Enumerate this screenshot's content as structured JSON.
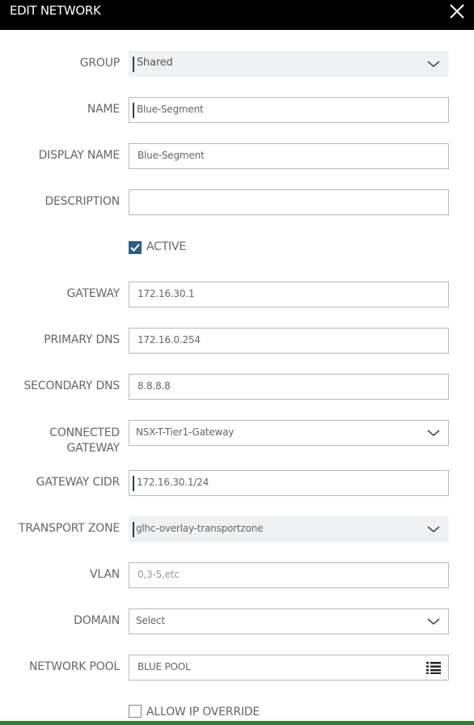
{
  "dialog": {
    "title": "EDIT NETWORK"
  },
  "form": {
    "group": {
      "label": "GROUP",
      "value": "Shared"
    },
    "name": {
      "label": "NAME",
      "value": "Blue-Segment"
    },
    "display_name": {
      "label": "DISPLAY NAME",
      "value": "Blue-Segment"
    },
    "description": {
      "label": "DESCRIPTION",
      "value": ""
    },
    "active": {
      "label": "ACTIVE",
      "checked": true
    },
    "gateway": {
      "label": "GATEWAY",
      "value": "172.16.30.1"
    },
    "primary_dns": {
      "label": "PRIMARY DNS",
      "value": "172.16.0.254"
    },
    "secondary_dns": {
      "label": "SECONDARY DNS",
      "value": "8.8.8.8"
    },
    "connected_gateway": {
      "label_line1": "CONNECTED",
      "label_line2": "GATEWAY",
      "value": "NSX-T-Tier1-Gateway"
    },
    "gateway_cidr": {
      "label": "GATEWAY CIDR",
      "value": "172.16.30.1/24"
    },
    "transport_zone": {
      "label": "TRANSPORT ZONE",
      "value": "glhc-overlay-transportzone"
    },
    "vlan": {
      "label": "VLAN",
      "placeholder": "0,3-5,etc"
    },
    "domain": {
      "label": "DOMAIN",
      "value": "Select"
    },
    "network_pool": {
      "label": "NETWORK POOL",
      "value": "BLUE POOL"
    },
    "allow_ip_override": {
      "label": "ALLOW IP OVERRIDE",
      "checked": false
    }
  },
  "colors": {
    "title_bar": "#000000",
    "checkbox_accent": "#2f5f7f",
    "bottom_bar": "#2e7d32"
  },
  "icons": {
    "close": "close-icon",
    "dropdown": "chevron-down-icon",
    "list": "list-icon",
    "check": "check-icon"
  }
}
